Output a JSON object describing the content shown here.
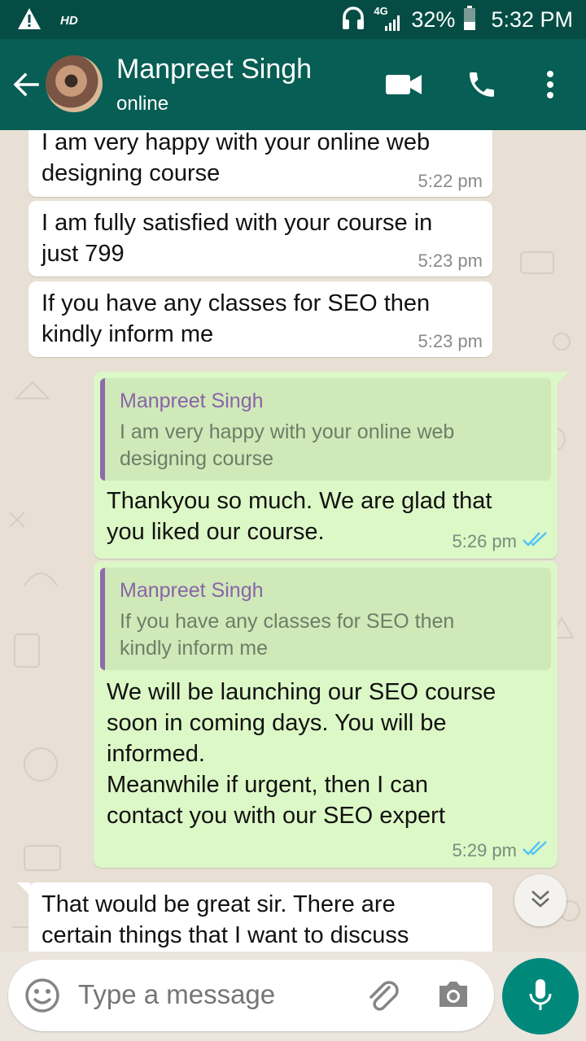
{
  "status_bar": {
    "hd_label": "HD",
    "network_label": "4G",
    "battery_percent": "32%",
    "time": "5:32 PM",
    "warning_icon": "warning-icon",
    "headset_icon": "headset-icon"
  },
  "header": {
    "contact_name": "Manpreet Singh",
    "contact_status": "online",
    "back_icon": "arrow-back-icon",
    "video_icon": "video-call-icon",
    "call_icon": "phone-icon",
    "menu_icon": "more-vert-icon"
  },
  "messages": [
    {
      "direction": "incoming",
      "text": "I am very happy with your online web\ndesigning course",
      "time": "5:22 pm"
    },
    {
      "direction": "incoming",
      "text": "I am fully satisfied with your course in\njust 799",
      "time": "5:23 pm"
    },
    {
      "direction": "incoming",
      "text": "If you have any classes for SEO then\nkindly inform me",
      "time": "5:23 pm"
    },
    {
      "direction": "outgoing",
      "quote_name": "Manpreet Singh",
      "quote_text": "I am very happy with your online web\ndesigning course",
      "text": "Thankyou so much. We are glad that\nyou liked our course.",
      "time": "5:26 pm",
      "read": true
    },
    {
      "direction": "outgoing",
      "quote_name": "Manpreet Singh",
      "quote_text": "If you have any classes for SEO then\nkindly inform me",
      "text": "We will be launching our SEO course\nsoon in coming days. You will be\ninformed.\nMeanwhile if urgent, then I can\ncontact you with our SEO expert",
      "time": "5:29 pm",
      "read": true
    },
    {
      "direction": "incoming",
      "text": "That would be great sir. There are\ncertain things that I want to discuss",
      "time": ""
    }
  ],
  "composer": {
    "placeholder": "Type a message",
    "emoji_icon": "emoji-icon",
    "attach_icon": "paperclip-icon",
    "camera_icon": "camera-icon",
    "mic_icon": "mic-icon",
    "scroll_icon": "chevron-double-down-icon"
  },
  "colors": {
    "header": "#075e54",
    "status_bar": "#054d44",
    "outgoing_bubble": "#dcf8c6",
    "incoming_bubble": "#ffffff",
    "mic_button": "#00897b",
    "quote_bar": "#8d6aab",
    "read_ticks": "#4fc3f7"
  }
}
